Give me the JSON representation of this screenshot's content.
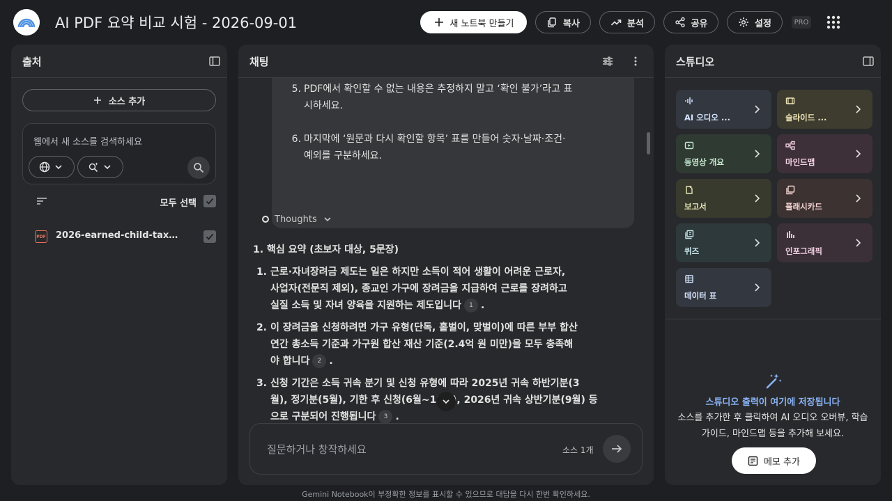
{
  "header": {
    "title": "AI PDF 요약 비교 시험 - 2026-09-01",
    "new_notebook": "새 노트북 만들기",
    "copy": "복사",
    "analyze": "분석",
    "share": "공유",
    "settings": "설정",
    "pro": "PRO"
  },
  "sources": {
    "title": "출처",
    "add_source": "소스 추가",
    "search_placeholder": "웹에서 새 소스를 검색하세요",
    "select_all": "모두 선택",
    "items": [
      {
        "name": "2026-earned-child-tax-...",
        "type": "PDF"
      }
    ]
  },
  "chat": {
    "title": "채팅",
    "prompt_items": [
      {
        "num": "5.",
        "lines": [
          "PDF에서 확인할 수 없는 내용은 추정하지 말고 ‘확인 불가’라고 표",
          "시하세요."
        ]
      },
      {
        "num": "6.",
        "lines": [
          "마지막에 ‘원문과 다시 확인할 항목’ 표를 만들어 숫자·날짜·조건·",
          "예외를 구분하세요."
        ]
      }
    ],
    "thoughts": "Thoughts",
    "answer_heading": "1. 핵심 요약 (초보자 대상, 5문장)",
    "answer_items": [
      {
        "num": "1.",
        "lines": [
          "근로·자녀장려금 제도는 일은 하지만 소득이 적어 생활이 어려운 근로자,",
          "사업자(전문직 제외), 종교인 가구에 장려금을 지급하여 근로를 장려하고",
          "실질 소득 및 자녀 양육을 지원하는 제도입니다"
        ],
        "cite": "1"
      },
      {
        "num": "2.",
        "lines": [
          "이 장려금을 신청하려면 가구 유형(단독, 홑벌이, 맞벌이)에 따른 부부 합산",
          "연간 총소득 기준과 가구원 합산 재산 기준(2.4억 원 미만)을 모두 충족해",
          "야 합니다"
        ],
        "cite": "2"
      },
      {
        "num": "3.",
        "lines": [
          "신청 기간은 소득 귀속 분기 및 신청 유형에 따라 2025년 귀속 하반기분(3",
          "월), 정기분(5월), 기한 후 신청(6월~11월), 2026년 귀속 상반기분(9월) 등",
          "으로 구분되어 진행됩니다"
        ],
        "cite": "3"
      }
    ],
    "input_placeholder": "질문하거나 창작하세요",
    "source_count": "소스 1개"
  },
  "studio": {
    "title": "스튜디오",
    "tiles": [
      {
        "label": "AI 오디오 ...",
        "icon": "audio-icon",
        "bg": "#33373f",
        "fg": "#d3e3fd"
      },
      {
        "label": "슬라이드 ...",
        "icon": "slides-icon",
        "bg": "#3d3c2e",
        "fg": "#f0e6b8"
      },
      {
        "label": "동영상 개요",
        "icon": "video-icon",
        "bg": "#2f3a33",
        "fg": "#c8ecd0"
      },
      {
        "label": "마인드맵",
        "icon": "mindmap-icon",
        "bg": "#3e3038",
        "fg": "#f5d3e6"
      },
      {
        "label": "보고서",
        "icon": "report-icon",
        "bg": "#393a2e",
        "fg": "#e6e6b8"
      },
      {
        "label": "플래시카드",
        "icon": "flashcards-icon",
        "bg": "#3d3232",
        "fg": "#f5d6d3"
      },
      {
        "label": "퀴즈",
        "icon": "quiz-icon",
        "bg": "#2e393b",
        "fg": "#c8e6ec"
      },
      {
        "label": "인포그래픽",
        "icon": "infographic-icon",
        "bg": "#3c3038",
        "fg": "#f2d0e4"
      },
      {
        "label": "데이터 표",
        "icon": "table-icon",
        "bg": "#33373f",
        "fg": "#d3e3fd"
      }
    ],
    "empty_title": "스튜디오 출력이 여기에 저장됩니다",
    "empty_desc": "소스를 추가한 후 클릭하여 AI 오디오 오버뷰, 학습 가이드, 마인드맵 등을 추가해 보세요.",
    "memo_button": "메모 추가"
  },
  "footer": "Gemini Notebook이 부정확한 정보를 표시할 수 있으므로 대답을 다시 한번 확인하세요."
}
